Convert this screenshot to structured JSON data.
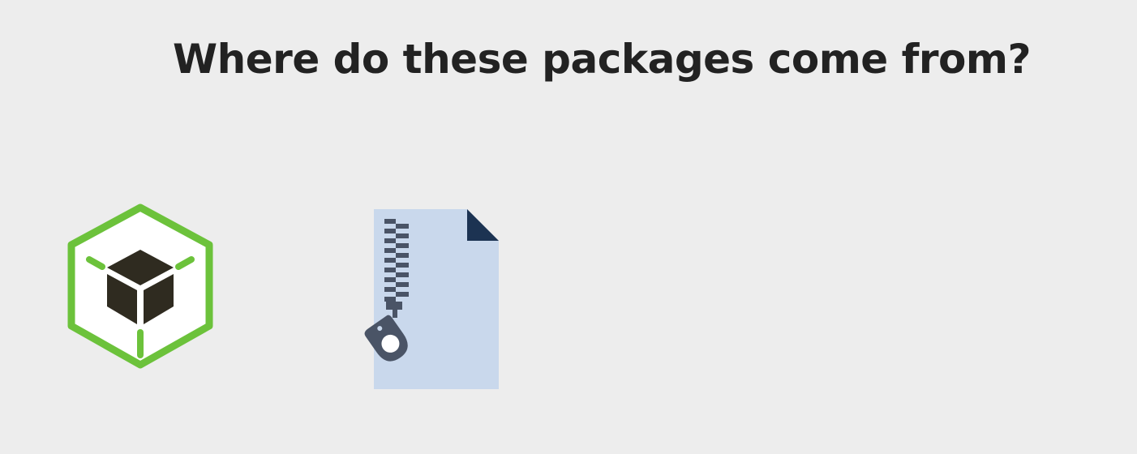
{
  "slide": {
    "title": "Where do these packages come from?"
  },
  "icons": {
    "package": {
      "name": "nuget-package-icon",
      "outline_color": "#6cc23b",
      "fill_color": "#ffffff",
      "cube_color": "#2f2b20"
    },
    "zip_file": {
      "name": "zip-file-icon",
      "page_color": "#c9d8ec",
      "corner_color": "#1c3352",
      "zipper_color": "#4a5466"
    }
  },
  "colors": {
    "background": "#ededed",
    "title_text": "#222222"
  }
}
